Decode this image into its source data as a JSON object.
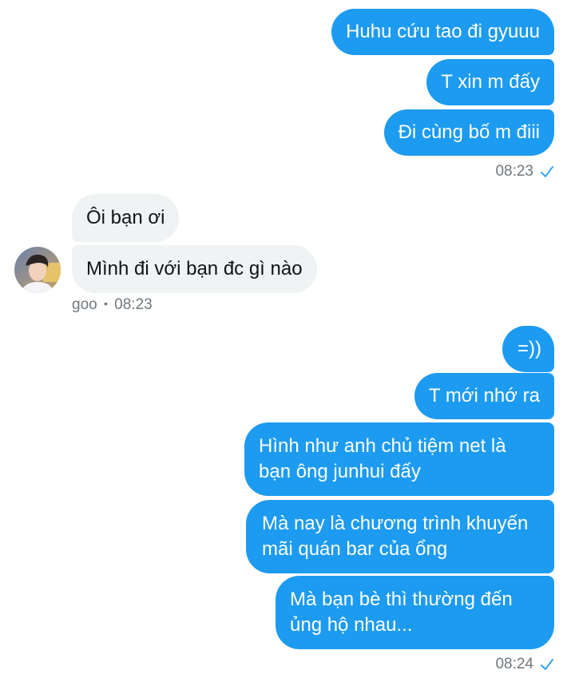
{
  "group1": {
    "messages": [
      "Huhu cứu tao đi gyuuu",
      "T xin m đấy",
      "Đi cùng bố m điii"
    ],
    "time": "08:23",
    "status_icon": "check-icon"
  },
  "incoming": {
    "messages": [
      "Ôi bạn ơi",
      "Mình đi với bạn đc gì nào"
    ],
    "sender": "goo",
    "separator": "•",
    "time": "08:23",
    "avatar_icon": "avatar"
  },
  "group2": {
    "messages": [
      "=))",
      "T mới nhớ ra",
      "Hình như anh chủ tiệm net là bạn ông junhui đấy",
      "Mà nay là chương trình khuyến mãi quán bar của ổng",
      "Mà bạn bè thì thường đến ủng hộ nhau..."
    ],
    "time": "08:24",
    "status_icon": "check-icon"
  },
  "colors": {
    "outgoing_bubble": "#1d9bf0",
    "incoming_bubble": "#eff3f4",
    "meta_text": "#70777c"
  }
}
